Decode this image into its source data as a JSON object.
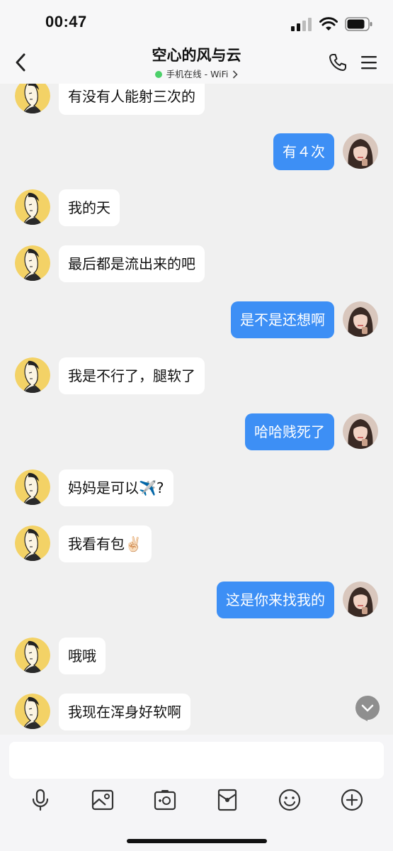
{
  "status_bar": {
    "time": "00:47"
  },
  "header": {
    "title": "空心的风与云",
    "status": "手机在线 - WiFi",
    "online_color": "#4cd06a"
  },
  "colors": {
    "outgoing_bubble": "#3d8ff5",
    "incoming_bubble": "#ffffff",
    "background": "#f0f0f0"
  },
  "messages": [
    {
      "side": "in",
      "text": "有没有人能射三次的"
    },
    {
      "side": "out",
      "text": "有４次"
    },
    {
      "side": "in",
      "text": "我的天"
    },
    {
      "side": "in",
      "text": "最后都是流出来的吧"
    },
    {
      "side": "out",
      "text": "是不是还想啊"
    },
    {
      "side": "in",
      "text": "我是不行了，腿软了"
    },
    {
      "side": "out",
      "text": "哈哈贱死了"
    },
    {
      "side": "in",
      "text": "妈妈是可以✈️?"
    },
    {
      "side": "in",
      "text": "我看有包✌🏻"
    },
    {
      "side": "out",
      "text": "这是你来找我的"
    },
    {
      "side": "in",
      "text": "哦哦"
    },
    {
      "side": "in",
      "text": "我现在浑身好软啊"
    }
  ],
  "toolbar": [
    "microphone-icon",
    "image-icon",
    "camera-icon",
    "red-packet-icon",
    "emoji-icon",
    "plus-icon"
  ]
}
